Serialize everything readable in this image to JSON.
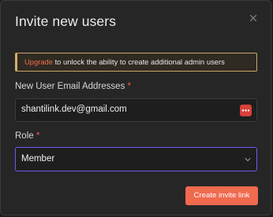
{
  "dialog": {
    "title": "Invite new users"
  },
  "banner": {
    "link_text": "Upgrade",
    "text": " to unlock the ability to create additional admin users"
  },
  "email": {
    "label": "New User Email Addresses",
    "required_mark": "*",
    "value": "shantilink.dev@gmail.com",
    "action_icon": "more-dots-icon"
  },
  "role": {
    "label": "Role",
    "required_mark": "*",
    "selected": "Member"
  },
  "actions": {
    "submit_label": "Create invite link"
  },
  "colors": {
    "accent": "#ef6a4f",
    "focus": "#6a5cf0",
    "banner_border": "#c9a76a",
    "required": "#ef5f52"
  }
}
